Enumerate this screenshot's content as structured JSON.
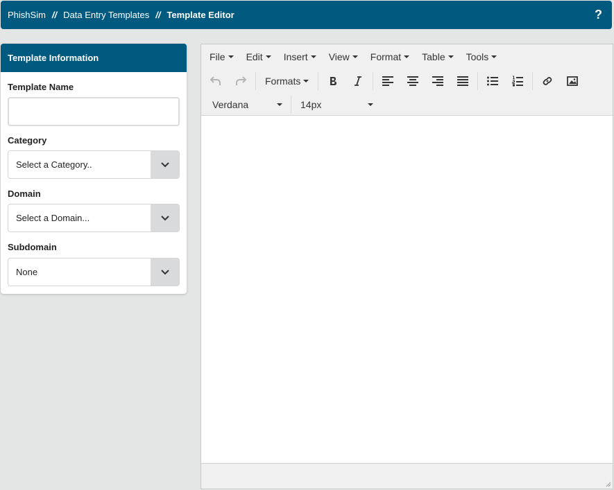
{
  "breadcrumb": {
    "items": [
      "PhishSim",
      "Data Entry Templates"
    ],
    "separator": "//",
    "current": "Template Editor"
  },
  "help_label": "?",
  "panel": {
    "title": "Template Information",
    "template_name_label": "Template Name",
    "template_name_value": "",
    "category_label": "Category",
    "category_value": "Select a Category..",
    "domain_label": "Domain",
    "domain_value": "Select a Domain...",
    "subdomain_label": "Subdomain",
    "subdomain_value": "None"
  },
  "editor": {
    "menu": [
      "File",
      "Edit",
      "Insert",
      "View",
      "Format",
      "Table",
      "Tools"
    ],
    "formats_label": "Formats",
    "font_family": "Verdana",
    "font_size": "14px"
  },
  "colors": {
    "brand": "#005a80",
    "background": "#e4e6e5",
    "toolbar": "#f0f0f0"
  }
}
